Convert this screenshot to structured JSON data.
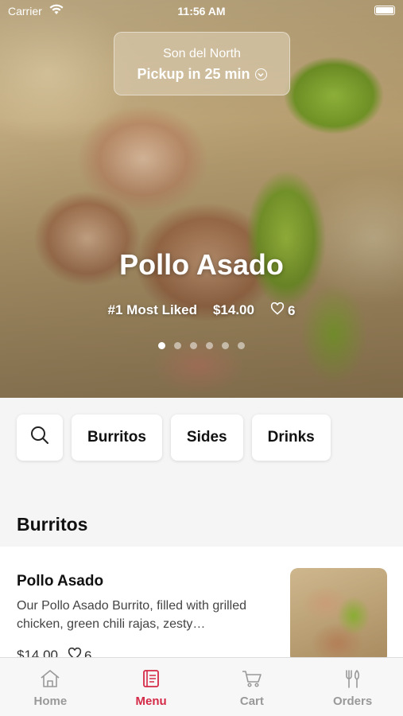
{
  "status_bar": {
    "carrier": "Carrier",
    "time": "11:56 AM"
  },
  "pickup": {
    "store": "Son del North",
    "eta": "Pickup in 25 min"
  },
  "hero": {
    "title": "Pollo Asado",
    "badge": "#1 Most Liked",
    "price": "$14.00",
    "likes": "6",
    "carousel_dots": 6,
    "active_dot": 1
  },
  "categories": [
    {
      "label": "Burritos"
    },
    {
      "label": "Sides"
    },
    {
      "label": "Drinks"
    }
  ],
  "section": {
    "title": "Burritos"
  },
  "menu_items": [
    {
      "name": "Pollo Asado",
      "description": "Our Pollo Asado Burrito, filled with grilled chicken, green chili rajas, zesty…",
      "price": "$14.00",
      "likes": "6"
    }
  ],
  "tabs": [
    {
      "label": "Home",
      "icon": "home-icon",
      "active": false
    },
    {
      "label": "Menu",
      "icon": "menu-book-icon",
      "active": true
    },
    {
      "label": "Cart",
      "icon": "cart-icon",
      "active": false
    },
    {
      "label": "Orders",
      "icon": "fork-knife-icon",
      "active": false
    }
  ],
  "colors": {
    "accent": "#d42a47",
    "inactive_tab": "#999999",
    "hero_text": "#ffffff"
  }
}
